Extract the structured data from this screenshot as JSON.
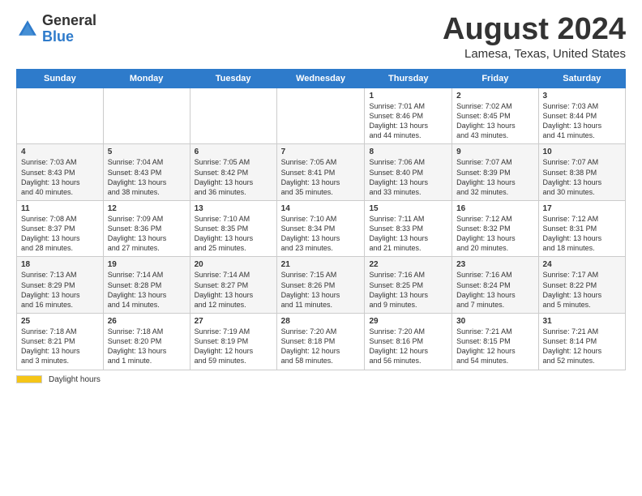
{
  "header": {
    "logo_general": "General",
    "logo_blue": "Blue",
    "title": "August 2024",
    "location": "Lamesa, Texas, United States"
  },
  "days_of_week": [
    "Sunday",
    "Monday",
    "Tuesday",
    "Wednesday",
    "Thursday",
    "Friday",
    "Saturday"
  ],
  "weeks": [
    [
      {
        "day": "",
        "info": ""
      },
      {
        "day": "",
        "info": ""
      },
      {
        "day": "",
        "info": ""
      },
      {
        "day": "",
        "info": ""
      },
      {
        "day": "1",
        "info": "Sunrise: 7:01 AM\nSunset: 8:46 PM\nDaylight: 13 hours\nand 44 minutes."
      },
      {
        "day": "2",
        "info": "Sunrise: 7:02 AM\nSunset: 8:45 PM\nDaylight: 13 hours\nand 43 minutes."
      },
      {
        "day": "3",
        "info": "Sunrise: 7:03 AM\nSunset: 8:44 PM\nDaylight: 13 hours\nand 41 minutes."
      }
    ],
    [
      {
        "day": "4",
        "info": "Sunrise: 7:03 AM\nSunset: 8:43 PM\nDaylight: 13 hours\nand 40 minutes."
      },
      {
        "day": "5",
        "info": "Sunrise: 7:04 AM\nSunset: 8:43 PM\nDaylight: 13 hours\nand 38 minutes."
      },
      {
        "day": "6",
        "info": "Sunrise: 7:05 AM\nSunset: 8:42 PM\nDaylight: 13 hours\nand 36 minutes."
      },
      {
        "day": "7",
        "info": "Sunrise: 7:05 AM\nSunset: 8:41 PM\nDaylight: 13 hours\nand 35 minutes."
      },
      {
        "day": "8",
        "info": "Sunrise: 7:06 AM\nSunset: 8:40 PM\nDaylight: 13 hours\nand 33 minutes."
      },
      {
        "day": "9",
        "info": "Sunrise: 7:07 AM\nSunset: 8:39 PM\nDaylight: 13 hours\nand 32 minutes."
      },
      {
        "day": "10",
        "info": "Sunrise: 7:07 AM\nSunset: 8:38 PM\nDaylight: 13 hours\nand 30 minutes."
      }
    ],
    [
      {
        "day": "11",
        "info": "Sunrise: 7:08 AM\nSunset: 8:37 PM\nDaylight: 13 hours\nand 28 minutes."
      },
      {
        "day": "12",
        "info": "Sunrise: 7:09 AM\nSunset: 8:36 PM\nDaylight: 13 hours\nand 27 minutes."
      },
      {
        "day": "13",
        "info": "Sunrise: 7:10 AM\nSunset: 8:35 PM\nDaylight: 13 hours\nand 25 minutes."
      },
      {
        "day": "14",
        "info": "Sunrise: 7:10 AM\nSunset: 8:34 PM\nDaylight: 13 hours\nand 23 minutes."
      },
      {
        "day": "15",
        "info": "Sunrise: 7:11 AM\nSunset: 8:33 PM\nDaylight: 13 hours\nand 21 minutes."
      },
      {
        "day": "16",
        "info": "Sunrise: 7:12 AM\nSunset: 8:32 PM\nDaylight: 13 hours\nand 20 minutes."
      },
      {
        "day": "17",
        "info": "Sunrise: 7:12 AM\nSunset: 8:31 PM\nDaylight: 13 hours\nand 18 minutes."
      }
    ],
    [
      {
        "day": "18",
        "info": "Sunrise: 7:13 AM\nSunset: 8:29 PM\nDaylight: 13 hours\nand 16 minutes."
      },
      {
        "day": "19",
        "info": "Sunrise: 7:14 AM\nSunset: 8:28 PM\nDaylight: 13 hours\nand 14 minutes."
      },
      {
        "day": "20",
        "info": "Sunrise: 7:14 AM\nSunset: 8:27 PM\nDaylight: 13 hours\nand 12 minutes."
      },
      {
        "day": "21",
        "info": "Sunrise: 7:15 AM\nSunset: 8:26 PM\nDaylight: 13 hours\nand 11 minutes."
      },
      {
        "day": "22",
        "info": "Sunrise: 7:16 AM\nSunset: 8:25 PM\nDaylight: 13 hours\nand 9 minutes."
      },
      {
        "day": "23",
        "info": "Sunrise: 7:16 AM\nSunset: 8:24 PM\nDaylight: 13 hours\nand 7 minutes."
      },
      {
        "day": "24",
        "info": "Sunrise: 7:17 AM\nSunset: 8:22 PM\nDaylight: 13 hours\nand 5 minutes."
      }
    ],
    [
      {
        "day": "25",
        "info": "Sunrise: 7:18 AM\nSunset: 8:21 PM\nDaylight: 13 hours\nand 3 minutes."
      },
      {
        "day": "26",
        "info": "Sunrise: 7:18 AM\nSunset: 8:20 PM\nDaylight: 13 hours\nand 1 minute."
      },
      {
        "day": "27",
        "info": "Sunrise: 7:19 AM\nSunset: 8:19 PM\nDaylight: 12 hours\nand 59 minutes."
      },
      {
        "day": "28",
        "info": "Sunrise: 7:20 AM\nSunset: 8:18 PM\nDaylight: 12 hours\nand 58 minutes."
      },
      {
        "day": "29",
        "info": "Sunrise: 7:20 AM\nSunset: 8:16 PM\nDaylight: 12 hours\nand 56 minutes."
      },
      {
        "day": "30",
        "info": "Sunrise: 7:21 AM\nSunset: 8:15 PM\nDaylight: 12 hours\nand 54 minutes."
      },
      {
        "day": "31",
        "info": "Sunrise: 7:21 AM\nSunset: 8:14 PM\nDaylight: 12 hours\nand 52 minutes."
      }
    ]
  ],
  "footer": {
    "daylight_label": "Daylight hours"
  }
}
